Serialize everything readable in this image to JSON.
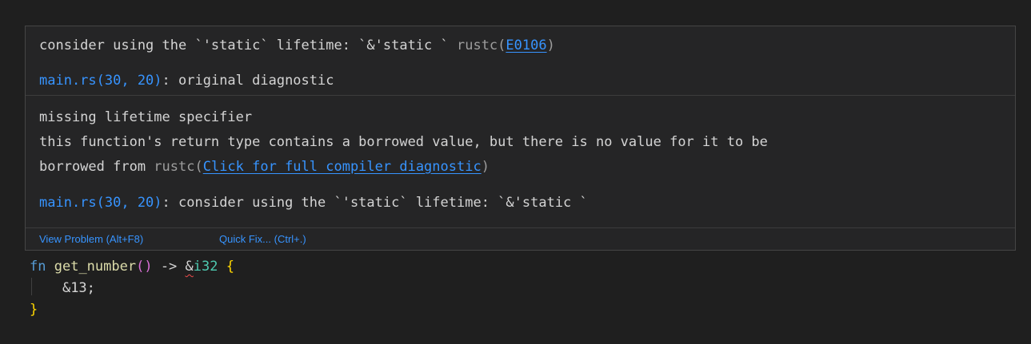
{
  "hover": {
    "quick_fix_message": {
      "text": "consider using the `'static` lifetime: `&'static ` ",
      "source": "rustc(",
      "code": "E0106",
      "close": ")"
    },
    "related_1": {
      "location": "main.rs(30, 20)",
      "separator": ": ",
      "message": "original diagnostic"
    },
    "diagnostic": {
      "line1": "missing lifetime specifier",
      "line2": "this function's return type contains a borrowed value, but there is no value for it to be",
      "line3_text": "borrowed from ",
      "source": "rustc(",
      "link": "Click for full compiler diagnostic",
      "close": ")"
    },
    "related_2": {
      "location": "main.rs(30, 20)",
      "separator": ": ",
      "message": "consider using the `'static` lifetime: `&'static `"
    },
    "actions": {
      "view_problem": "View Problem (Alt+F8)",
      "quick_fix": "Quick Fix... (Ctrl+.)"
    }
  },
  "code": {
    "line1": {
      "kw": "fn",
      "sp1": " ",
      "fn_name": "get_number",
      "parens": "()",
      "arrow": " -> ",
      "amp": "&",
      "type": "i32",
      "sp2": " ",
      "brace": "{"
    },
    "line2": {
      "indent": "    ",
      "text": "&13;"
    },
    "line3": {
      "brace": "}"
    }
  },
  "colors": {
    "background": "#1f1f1f",
    "hover_background": "#252526",
    "link": "#3794ff",
    "error_squiggle": "#f14c4c"
  }
}
